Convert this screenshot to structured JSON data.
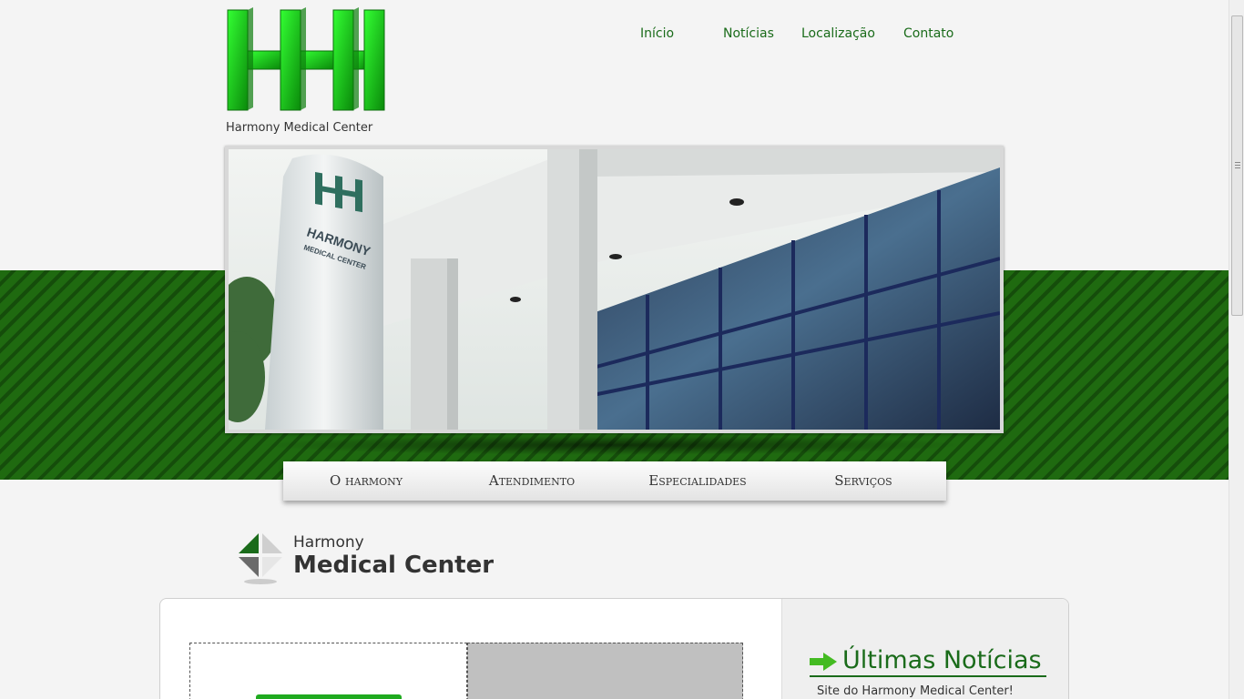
{
  "brand": {
    "caption": "Harmony Medical Center",
    "color": "#22cc22"
  },
  "top_nav": [
    {
      "label": "Início"
    },
    {
      "label": "Notícias"
    },
    {
      "label": "Localização"
    },
    {
      "label": "Contato"
    }
  ],
  "sub_menu": [
    {
      "label": "O harmony"
    },
    {
      "label": "Atendimento"
    },
    {
      "label": "Especialidades"
    },
    {
      "label": "Serviços"
    }
  ],
  "section": {
    "title_small": "Harmony",
    "title_big": "Medical Center"
  },
  "news": {
    "title": "Últimas Notícias",
    "items": [
      "Site do Harmony Medical Center!"
    ]
  },
  "colors": {
    "accent": "#1a6b1a",
    "band_dark": "#154d0b",
    "band_light": "#1f6a10"
  }
}
